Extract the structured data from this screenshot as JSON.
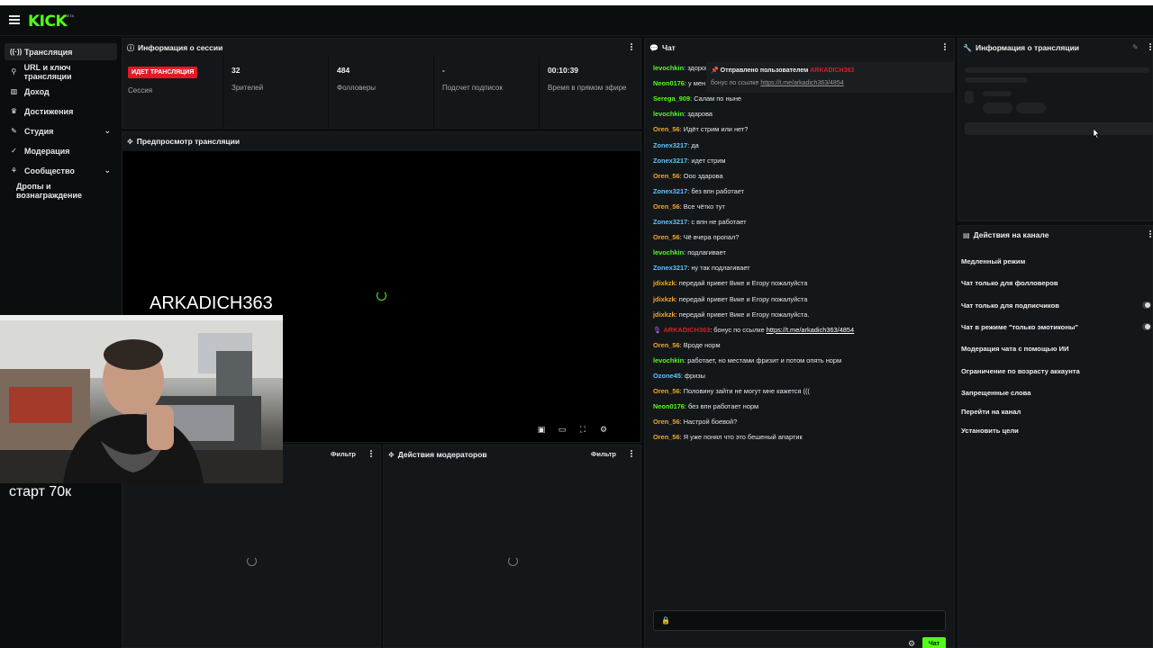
{
  "brand": {
    "logo": "KICK",
    "beta": "BETA"
  },
  "sidebar": {
    "items": [
      {
        "label": "Трансляция"
      },
      {
        "label": "URL и ключ трансляции"
      },
      {
        "label": "Доход"
      },
      {
        "label": "Достижения"
      },
      {
        "label": "Студия"
      },
      {
        "label": "Модерация"
      },
      {
        "label": "Сообщество"
      },
      {
        "label": "Дропы и вознаграждение"
      }
    ]
  },
  "session": {
    "title": "Информация о сессии",
    "status_badge": "ИДЕТ ТРАНСЛЯЦИЯ",
    "status_label": "Сессия",
    "viewers_value": "32",
    "viewers_label": "Зрителей",
    "followers_value": "484",
    "followers_label": "Фолловеры",
    "subs_value": "-",
    "subs_label": "Подсчет подписок",
    "uptime_value": "00:10:39",
    "uptime_label": "Время в прямом эфире"
  },
  "preview": {
    "title": "Предпросмотр трансляции",
    "overlay_name": "ARKADICH363",
    "overlay_text": "старт 70к"
  },
  "bottom_left": {
    "filter": "Фильтр"
  },
  "mod_actions": {
    "title": "Действия модераторов",
    "filter": "Фильтр"
  },
  "chat": {
    "title": "Чат",
    "pinned_by": "Отправлено пользователем",
    "pinned_user": "ARKADICH363",
    "pinned_text": "бонус по ссылке",
    "pinned_link": "https://t.me/arkadich363/4854",
    "send_label": "Чат",
    "messages": [
      {
        "user": "levochkin",
        "color": "#53fc18",
        "text": "здоров"
      },
      {
        "user": "Neon0176",
        "color": "#53fc18",
        "text": "у мен"
      },
      {
        "user": "Serega_909",
        "color": "#53fc18",
        "text": "Салам по ныне"
      },
      {
        "user": "levochkin",
        "color": "#53fc18",
        "text": "здарова"
      },
      {
        "user": "Oren_56",
        "color": "#f5a623",
        "text": "Идёт стрим или нет?"
      },
      {
        "user": "Zonex3217",
        "color": "#5ec6ff",
        "text": "да"
      },
      {
        "user": "Zonex3217",
        "color": "#5ec6ff",
        "text": "идет стрим"
      },
      {
        "user": "Oren_56",
        "color": "#f5a623",
        "text": "Ооо здарова"
      },
      {
        "user": "Zonex3217",
        "color": "#5ec6ff",
        "text": "без впн работает"
      },
      {
        "user": "Oren_56",
        "color": "#f5a623",
        "text": "Все чётко тут"
      },
      {
        "user": "Zonex3217",
        "color": "#5ec6ff",
        "text": "с впн не работает"
      },
      {
        "user": "Oren_56",
        "color": "#f5a623",
        "text": "Чё вчера пропал?"
      },
      {
        "user": "levochkin",
        "color": "#53fc18",
        "text": "подлагивает"
      },
      {
        "user": "Zonex3217",
        "color": "#5ec6ff",
        "text": "ну так подлагивает"
      },
      {
        "user": "jdixkzk",
        "color": "#f5a623",
        "text": "передай привет Вике и Егору пожалуйста"
      },
      {
        "user": "jdixkzk",
        "color": "#f5a623",
        "text": "передай привет Вике и Егору пожалуйста"
      },
      {
        "user": "jdixkzk",
        "color": "#f5a623",
        "text": "передай привет Вике и Егору пожалуйста."
      },
      {
        "user": "ARKADICH363",
        "color": "#e21a26",
        "text": "бонус по ссылке",
        "link": "https://t.me/arkadich363/4854"
      },
      {
        "user": "Oren_56",
        "color": "#f5a623",
        "text": "Вроде норм"
      },
      {
        "user": "levochkin",
        "color": "#53fc18",
        "text": "работает, но местами фризит и потом опять норм"
      },
      {
        "user": "Ozone45",
        "color": "#5ec6ff",
        "text": "фризы"
      },
      {
        "user": "Oren_56",
        "color": "#f5a623",
        "text": "Половину зайти не могут мне кажется ((("
      },
      {
        "user": "Neon0176",
        "color": "#53fc18",
        "text": "без впн работает норм"
      },
      {
        "user": "Oren_56",
        "color": "#f5a623",
        "text": "Настрой боевой?"
      },
      {
        "user": "Oren_56",
        "color": "#f5a623",
        "text": "Я уже понял что это бешеный апартик"
      }
    ]
  },
  "stream_info": {
    "title": "Информация о трансляции"
  },
  "channel_actions": {
    "title": "Действия на канале",
    "items": [
      "Медленный режим",
      "Чат только для фолловеров",
      "Чат только для подписчиков",
      "Чат в режиме \"только эмотиконы\"",
      "Модерация чата с помощью ИИ",
      "Ограничение по возрасту аккаунта",
      "Запрещенные слова",
      "Перейти на канал",
      "Установить цели"
    ]
  },
  "colors": {
    "accent": "#53fc18",
    "live": "#e21a26",
    "bg": "#0b0e0f",
    "panel": "#141719"
  }
}
